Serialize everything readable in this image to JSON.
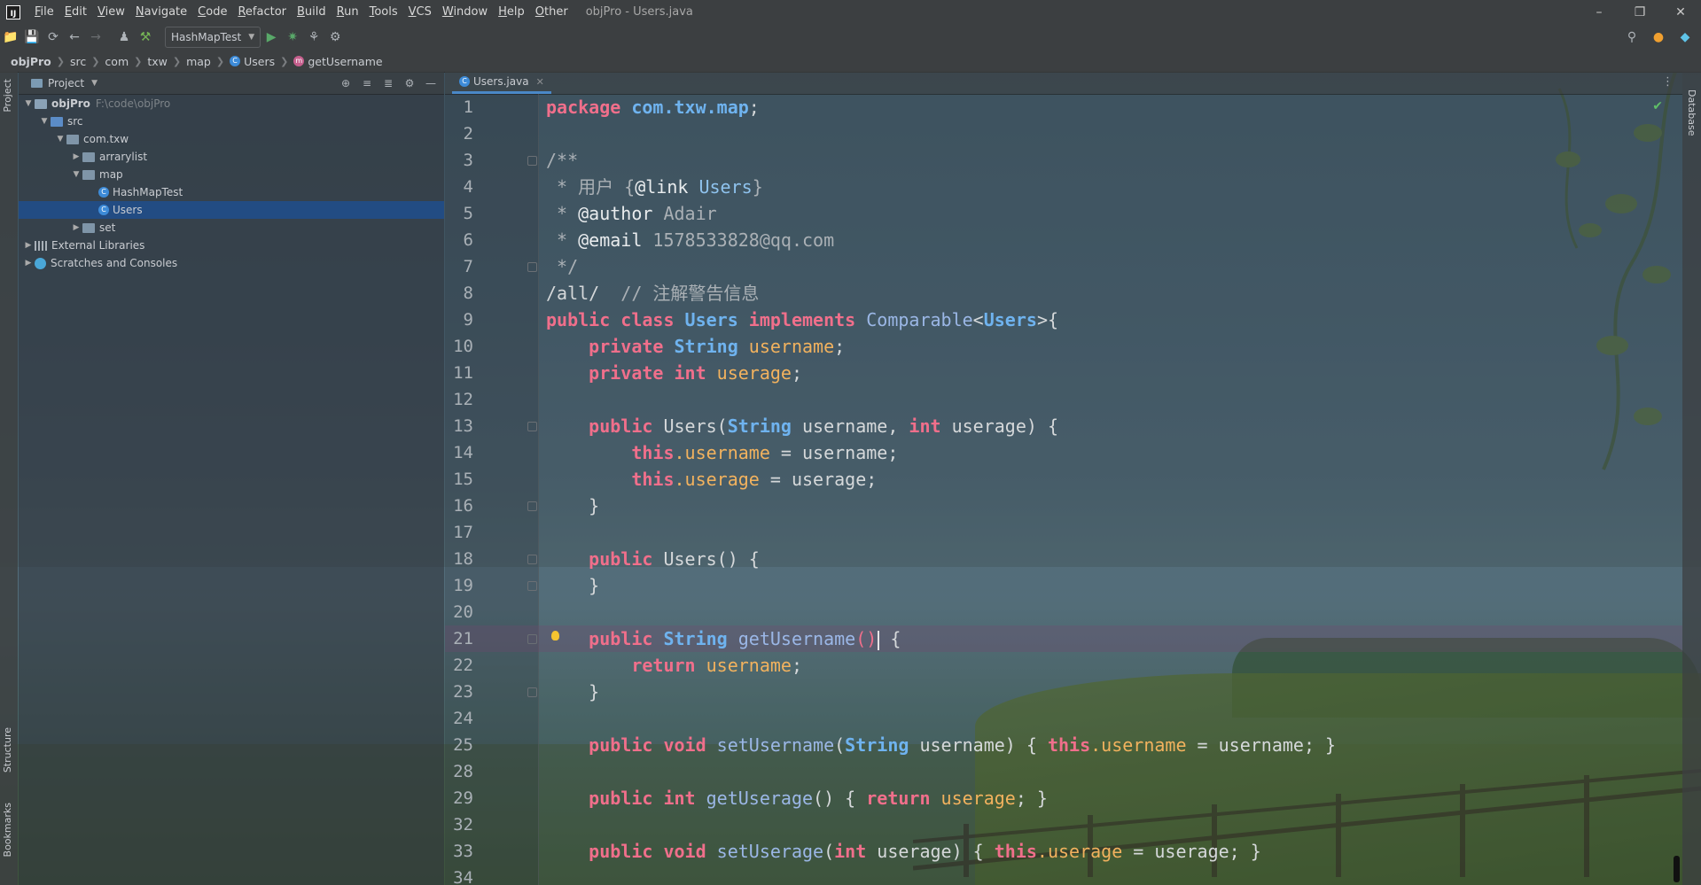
{
  "window": {
    "title": "objPro - Users.java",
    "menu": [
      "File",
      "Edit",
      "View",
      "Navigate",
      "Code",
      "Refactor",
      "Build",
      "Run",
      "Tools",
      "VCS",
      "Window",
      "Help",
      "Other"
    ],
    "controls": [
      "minimize-icon",
      "restore-icon",
      "close-icon"
    ]
  },
  "toolbar": {
    "run_config": "HashMapTest"
  },
  "breadcrumb": [
    "objPro",
    "src",
    "com",
    "txw",
    "map",
    "Users",
    "getUsername"
  ],
  "left_strip": {
    "project": "Project",
    "structure": "Structure",
    "bookmarks": "Bookmarks"
  },
  "right_strip": {
    "database": "Database"
  },
  "project": {
    "header": "Project",
    "tree": [
      {
        "label": "objPro",
        "hint": "F:\\code\\objPro"
      },
      {
        "label": "src"
      },
      {
        "label": "com.txw"
      },
      {
        "label": "arrarylist"
      },
      {
        "label": "map"
      },
      {
        "label": "HashMapTest"
      },
      {
        "label": "Users"
      },
      {
        "label": "set"
      },
      {
        "label": "External Libraries"
      },
      {
        "label": "Scratches and Consoles"
      }
    ]
  },
  "editor": {
    "tab": "Users.java",
    "line_numbers": [
      "1",
      "2",
      "3",
      "4",
      "5",
      "6",
      "7",
      "8",
      "9",
      "10",
      "11",
      "12",
      "13",
      "14",
      "15",
      "16",
      "17",
      "18",
      "19",
      "20",
      "21",
      "22",
      "23",
      "24",
      "25",
      "28",
      "29",
      "32",
      "33",
      "34"
    ],
    "code": {
      "l1": [
        "package",
        " com.txw.map",
        ";"
      ],
      "l3": "/**",
      "l4": [
        " * 用户 {",
        "@link",
        " Users",
        "}"
      ],
      "l5": [
        " * ",
        "@author",
        " Adair"
      ],
      "l6": [
        " * ",
        "@email",
        " 1578533828@qq.com"
      ],
      "l7": " */",
      "l8": [
        "/all/  ",
        "// 注解警告信息"
      ],
      "l9": [
        "public class",
        " Users ",
        "implements",
        " Comparable",
        "<",
        "Users",
        ">{"
      ],
      "l10": [
        "    private ",
        "String",
        " username",
        ";"
      ],
      "l11": [
        "    private int",
        " userage",
        ";"
      ],
      "l13": [
        "    public",
        " Users(",
        "String",
        " username, ",
        "int",
        " userage) {"
      ],
      "l14": [
        "        this",
        ".username",
        " = username;"
      ],
      "l15": [
        "        this",
        ".userage",
        " = userage;"
      ],
      "l16": "    }",
      "l18": [
        "    public",
        " Users() {"
      ],
      "l19": "    }",
      "l21": [
        "    public ",
        "String",
        " getUsername",
        "()",
        " {"
      ],
      "l22": [
        "        return",
        " username",
        ";"
      ],
      "l23": "    }",
      "l25": [
        "    public void",
        " setUsername",
        "(",
        "String",
        " username) { ",
        "this",
        ".username",
        " = username; }"
      ],
      "l29": [
        "    public int",
        " getUserage",
        "() { ",
        "return",
        " userage",
        "; }"
      ],
      "l33": [
        "    public void",
        " setUserage",
        "(",
        "int",
        " userage) { ",
        "this",
        ".userage",
        " = userage; }"
      ]
    }
  },
  "colors": {
    "keyword": "#f06f8b",
    "type": "#6fb3ef",
    "field": "#f2b25e",
    "method": "#9bb7e6",
    "comment": "#aab0b5",
    "selection": "#204e8a"
  }
}
